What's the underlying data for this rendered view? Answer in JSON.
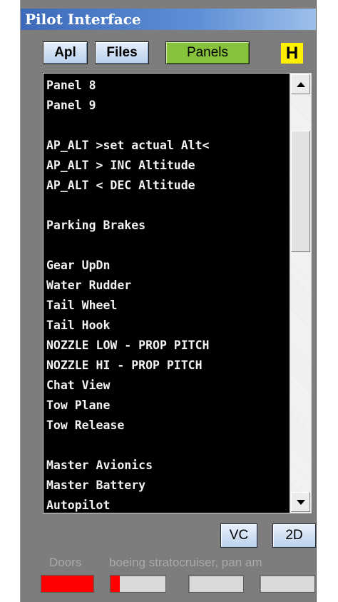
{
  "window": {
    "title": "Pilot Interface"
  },
  "toolbar": {
    "apl_label": "Apl",
    "files_label": "Files",
    "panels_label": "Panels",
    "h_badge": "H"
  },
  "list": {
    "items": [
      "Panel 8",
      "Panel 9",
      "",
      "AP_ALT >set actual Alt<",
      "AP_ALT > INC Altitude",
      "AP_ALT < DEC Altitude",
      "",
      "Parking Brakes",
      "",
      "Gear UpDn",
      "Water Rudder",
      "Tail Wheel",
      "Tail Hook",
      "NOZZLE LOW - PROP PITCH",
      "NOZZLE HI - PROP PITCH",
      "Chat View",
      "Tow Plane",
      "Tow Release",
      "",
      "Master Avionics",
      "Master Battery",
      "Autopilot"
    ]
  },
  "view_buttons": {
    "vc_label": "VC",
    "twod_label": "2D"
  },
  "status": {
    "doors_label": "Doors",
    "aircraft_label": "boeing stratocruiser, pan am",
    "doors_level": 1.0,
    "gauge1_level": 0.17,
    "gauge2_level": 0.0,
    "gauge3_level": 0.0
  },
  "colors": {
    "title_blue": "#3d6ab8",
    "panels_green": "#86c23c",
    "h_yellow": "#ffef00",
    "gauge_red": "#ff0000"
  }
}
